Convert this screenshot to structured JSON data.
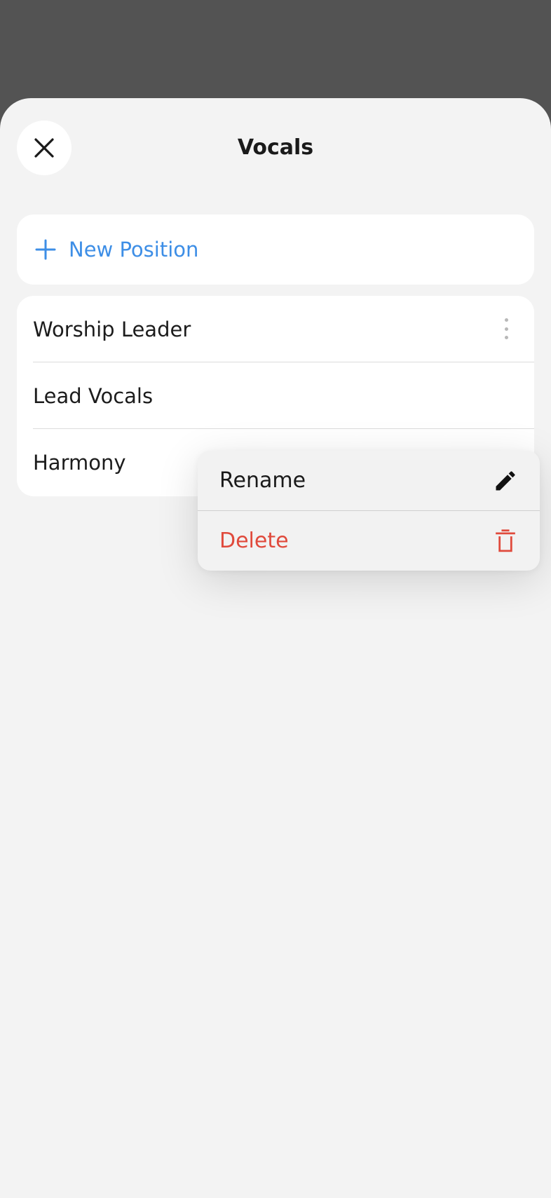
{
  "sheet": {
    "title": "Vocals",
    "close_icon": "close-icon"
  },
  "new_position": {
    "label": "New Position",
    "icon": "plus-icon",
    "color": "#3d8ee6"
  },
  "positions": [
    {
      "label": "Worship Leader"
    },
    {
      "label": "Lead Vocals"
    },
    {
      "label": "Harmony"
    }
  ],
  "context_menu": {
    "items": [
      {
        "label": "Rename",
        "icon": "pencil-icon",
        "color": "#1a1a1a"
      },
      {
        "label": "Delete",
        "icon": "trash-icon",
        "color": "#e04a3c"
      }
    ]
  }
}
